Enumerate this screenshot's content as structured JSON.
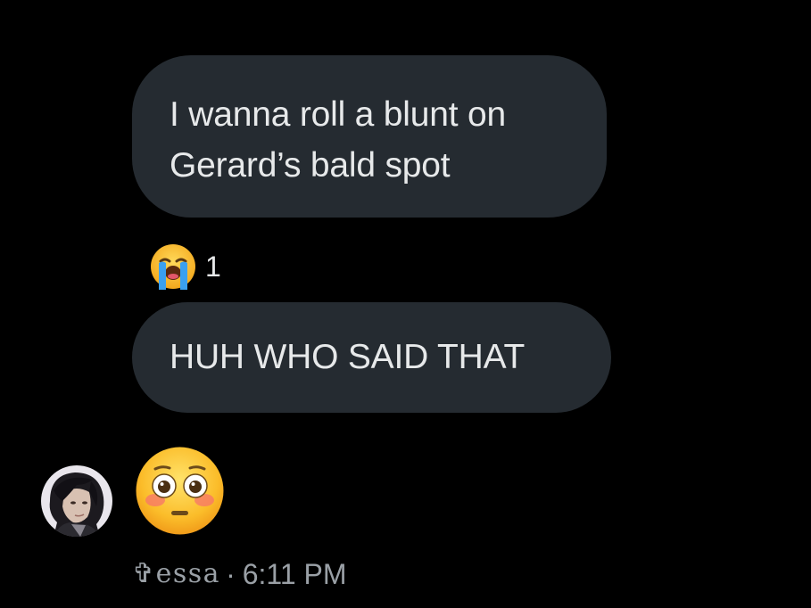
{
  "messages": [
    {
      "lines": [
        "I wanna roll a blunt on",
        "Gerard’s bald spot"
      ]
    },
    {
      "text": "HUH WHO SAID THAT"
    }
  ],
  "reaction": {
    "emoji": "loudly-crying-face",
    "count": "1"
  },
  "last_message": {
    "emoji": "flushed-face",
    "sender": "✞essa",
    "separator": "·",
    "time": "6:11 PM"
  },
  "colors": {
    "background": "#000000",
    "bubble": "#252b31",
    "text": "#e7e9ea",
    "meta": "#9aa0a6"
  }
}
